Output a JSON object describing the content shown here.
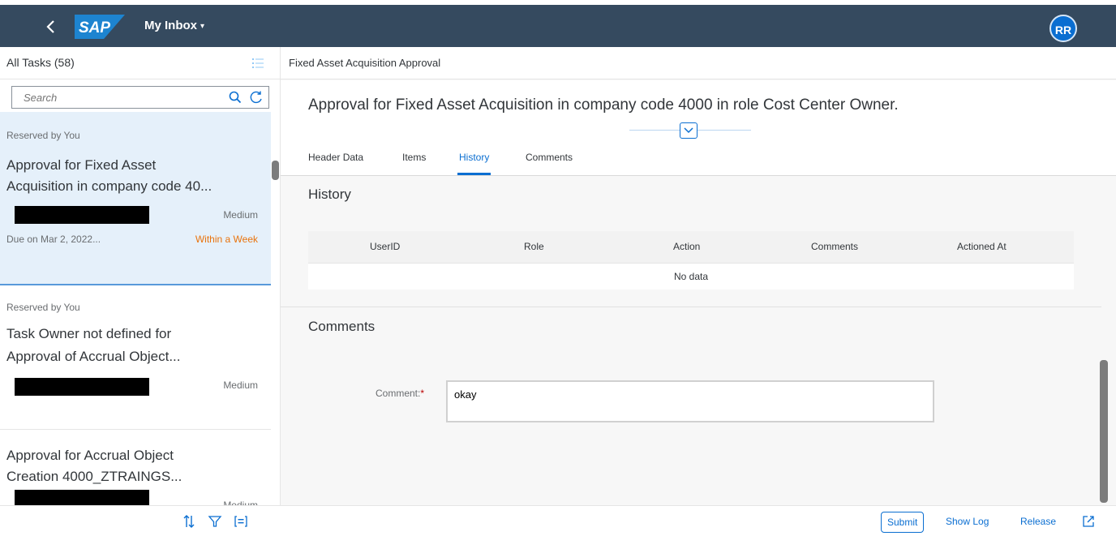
{
  "shell": {
    "back_icon": "chevron-left-icon",
    "logo": "SAP",
    "app_title": "My Inbox",
    "caret": "▾",
    "avatar": "RR",
    "colors": {
      "shell_bg": "#354a5f",
      "avatar_bg": "#0a6ed1",
      "logo_blue": "#1d84d0"
    }
  },
  "master": {
    "title": "All Tasks (58)",
    "search_placeholder": "Search",
    "items": [
      {
        "reserved": "Reserved by You",
        "title_line1": "Approval for Fixed Asset",
        "title_line2": "Acquisition in company code 40...",
        "priority": "Medium",
        "due": "Due on Mar 2, 2022...",
        "due_status": "Within a Week",
        "selected": true
      },
      {
        "reserved": "Reserved by You",
        "title_line1": "Task Owner not defined for",
        "title_line2": "Approval of Accrual Object...",
        "priority": "Medium"
      },
      {
        "title_line1": "Approval for Accrual Object",
        "title_line2": "Creation 4000_ZTRAINGS...",
        "priority": "Medium"
      }
    ],
    "footer_icons": [
      "sort-icon",
      "filter-icon",
      "group-icon"
    ]
  },
  "detail": {
    "top_title": "Fixed Asset Acquisition Approval",
    "object_title": "Approval for Fixed Asset Acquisition in company code 4000 in role Cost Center Owner.",
    "tabs": [
      "Header Data",
      "Items",
      "History",
      "Comments"
    ],
    "active_tab": "History",
    "history": {
      "title": "History",
      "columns": [
        "UserID",
        "Role",
        "Action",
        "Comments",
        "Actioned At"
      ],
      "empty_text": "No data"
    },
    "comments": {
      "title": "Comments",
      "label": "Comment:",
      "required_mark": "*",
      "value": "okay"
    },
    "footer": {
      "submit": "Submit",
      "show_log": "Show Log",
      "release": "Release"
    }
  }
}
